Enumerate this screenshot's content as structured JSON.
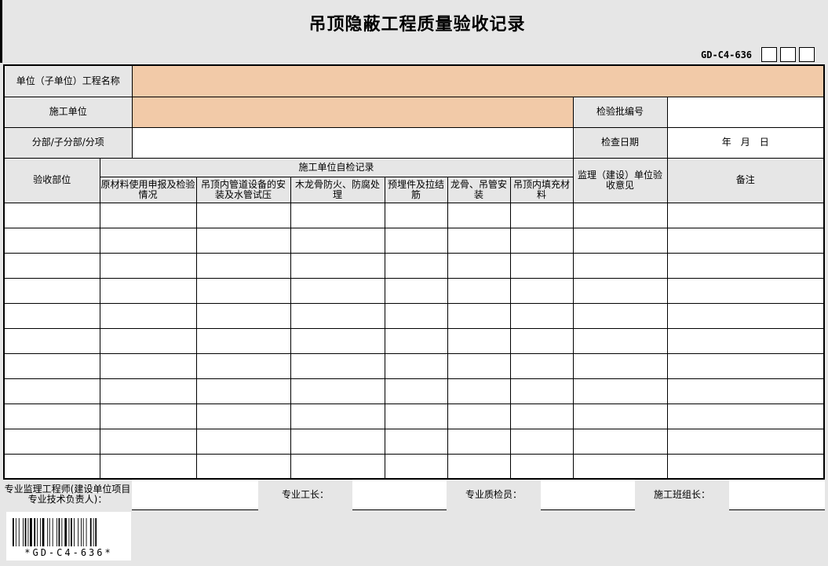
{
  "title": "吊顶隐蔽工程质量验收记录",
  "form_code": "GD-C4-636",
  "rows": {
    "unit_project_label": "单位（子单位）工程名称",
    "contractor_label": "施工单位",
    "batch_no_label": "检验批编号",
    "division_label": "分部/子分部/分项",
    "inspect_date_label": "检查日期",
    "date_value": "年　月　日"
  },
  "headers": {
    "location": "验收部位",
    "self_check": "施工单位自检记录",
    "col1": "原材料使用申报及检验情况",
    "col2": "吊顶内管道设备的安装及水管试压",
    "col3": "木龙骨防火、防腐处理",
    "col4": "预埋件及拉结筋",
    "col5": "龙骨、吊管安装",
    "col6": "吊顶内填充材料",
    "supervision": "监理（建设）单位验收意见",
    "remarks": "备注"
  },
  "signatures": {
    "engineer": "专业监理工程师(建设单位项目专业技术负责人)：",
    "foreman": "专业工长：",
    "inspector": "专业质检员：",
    "team_leader": "施工班组长："
  },
  "barcode": {
    "text": "*GD-C4-636*"
  }
}
